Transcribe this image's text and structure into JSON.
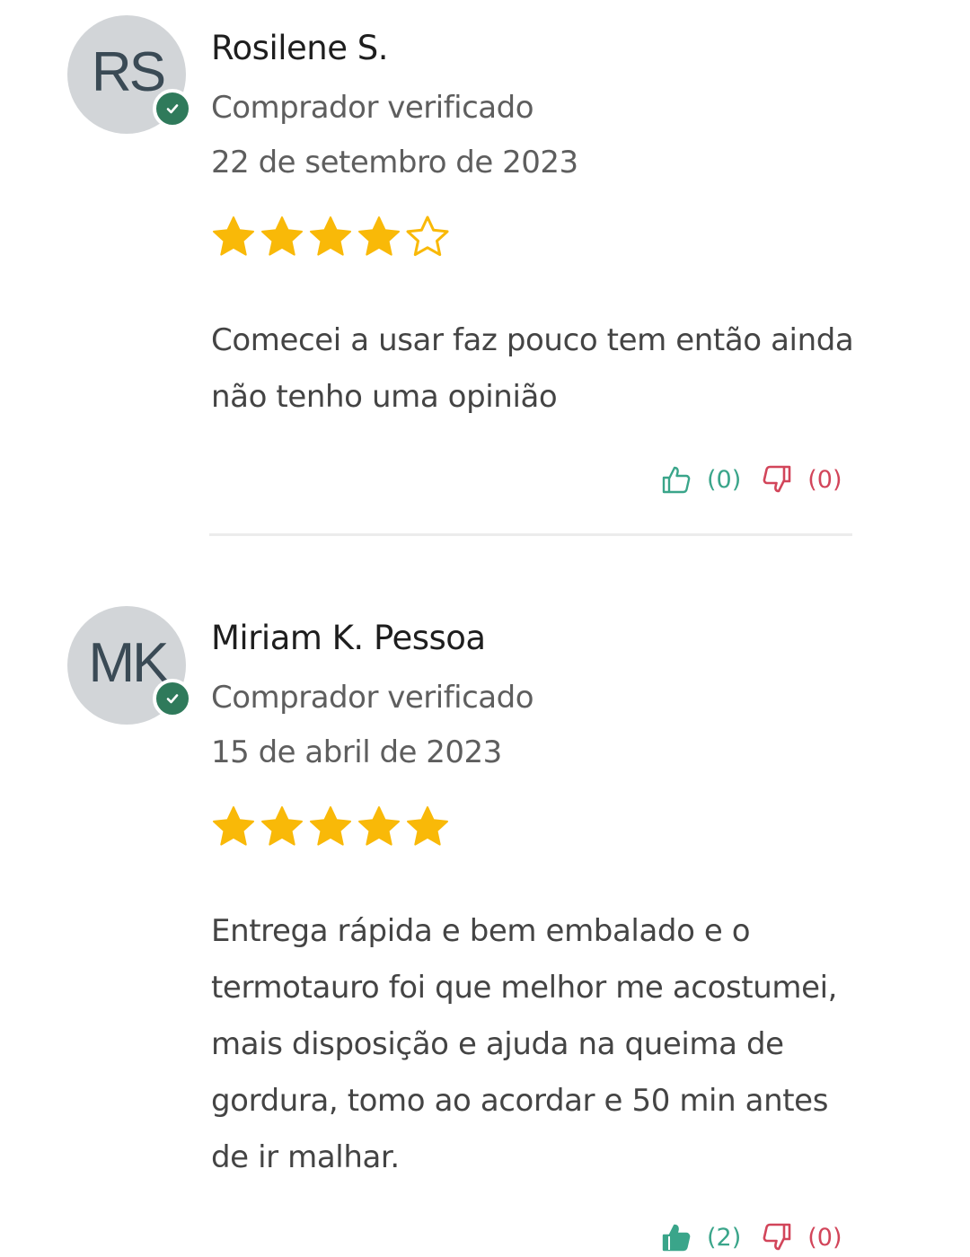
{
  "reviews": [
    {
      "initials": "RS",
      "name": "Rosilene S.",
      "verified_label": "Comprador verificado",
      "date": "22 de setembro de 2023",
      "rating": 4,
      "rating_max": 5,
      "text": "Comecei a usar faz pouco tem então ainda não tenho uma opinião",
      "helpful_count": "(0)",
      "not_helpful_count": "(0)"
    },
    {
      "initials": "MK",
      "name": "Miriam K. Pessoa",
      "verified_label": "Comprador verificado",
      "date": "15 de abril de 2023",
      "rating": 5,
      "rating_max": 5,
      "text": "Entrega rápida e bem embalado e o termotauro foi que melhor me acostumei, mais disposição e ajuda na queima de gordura, tomo ao acordar e 50 min antes de ir malhar.",
      "helpful_count": "(2)",
      "not_helpful_count": "(0)"
    }
  ],
  "colors": {
    "star_fill": "#f9b908",
    "verified_badge": "#2f7a5b",
    "helpful": "#3aa58a",
    "not_helpful": "#d2455a"
  },
  "icons": {
    "verified": "check-circle-icon",
    "star_filled": "star-filled-icon",
    "star_empty": "star-outline-icon",
    "helpful": "thumbs-up-icon",
    "not_helpful": "thumbs-down-icon"
  }
}
